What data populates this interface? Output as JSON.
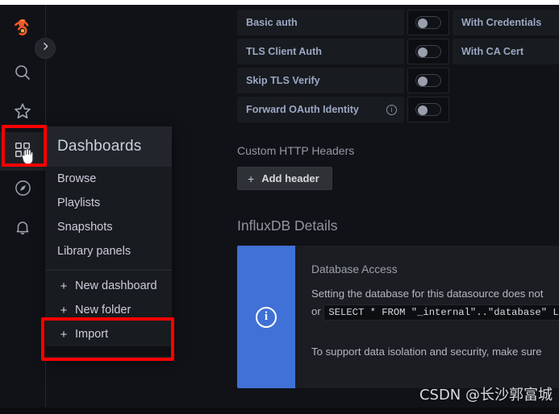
{
  "app": {
    "name": "Grafana"
  },
  "rail": {
    "logo_icon": "grafana-logo-icon",
    "expand_icon": "chevron-right-icon",
    "items": [
      {
        "icon": "search-icon",
        "name": "search"
      },
      {
        "icon": "star-icon",
        "name": "starred"
      },
      {
        "icon": "dashboards-apps-icon",
        "name": "dashboards"
      },
      {
        "icon": "compass-explore-icon",
        "name": "explore"
      },
      {
        "icon": "bell-alerting-icon",
        "name": "alerting"
      }
    ]
  },
  "menu": {
    "title": "Dashboards",
    "items": [
      {
        "label": "Browse"
      },
      {
        "label": "Playlists"
      },
      {
        "label": "Snapshots"
      },
      {
        "label": "Library panels"
      }
    ],
    "create_items": [
      {
        "plus": "+",
        "label": "New dashboard"
      },
      {
        "plus": "+",
        "label": "New folder"
      },
      {
        "plus": "+",
        "label": "Import"
      }
    ]
  },
  "settings": {
    "auth_rows": [
      {
        "label": "Basic auth",
        "info": "",
        "toggle": "off",
        "right_label": "With Credentials"
      },
      {
        "label": "TLS Client Auth",
        "info": "",
        "toggle": "off",
        "right_label": "With CA Cert"
      },
      {
        "label": "Skip TLS Verify",
        "info": "",
        "toggle": "off",
        "right_label": ""
      },
      {
        "label": "Forward OAuth Identity",
        "info": "i",
        "toggle": "off",
        "right_label": ""
      }
    ],
    "custom_headers_title": "Custom HTTP Headers",
    "add_header_plus": "+",
    "add_header_label": "Add header",
    "influx_title": "InfluxDB Details",
    "alert": {
      "icon": "info-circle-icon",
      "title": "Database Access",
      "line1_prefix": "Setting the database for this datasource does not",
      "line2_prefix": "or",
      "line2_code": "SELECT * FROM \"_internal\"..\"database\" LIM",
      "line3": "To support data isolation and security, make sure"
    }
  },
  "watermark": {
    "text": "CSDN @长沙郭富城"
  },
  "colors": {
    "accent_blue": "#4071d6",
    "highlight_red": "#ff0000",
    "panel_bg": "#111217",
    "field_bg": "#181b1f",
    "label_blue": "#9ba7c4"
  }
}
